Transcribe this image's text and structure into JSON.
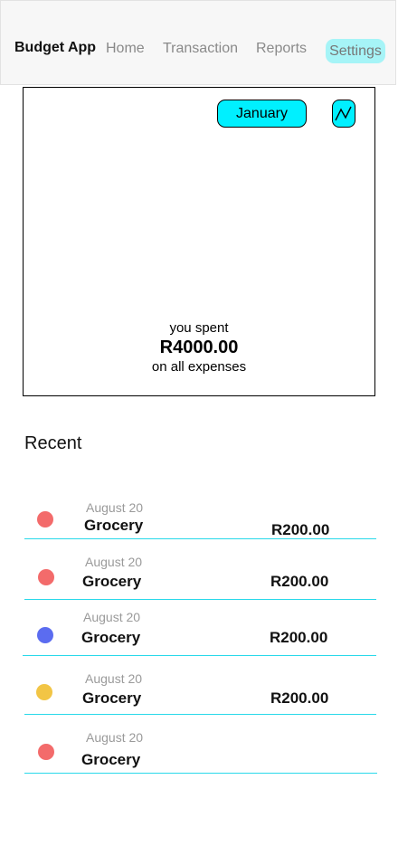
{
  "header": {
    "brand": "Budget App",
    "nav": [
      "Home",
      "Transaction",
      "Reports",
      "Settings"
    ]
  },
  "summary": {
    "month": "January",
    "chart_icon": "line-chart-icon",
    "spent_label": "you spent",
    "total": "R4000.00",
    "note": "on all expenses"
  },
  "recent": {
    "title": "Recent",
    "items": [
      {
        "date": "August 20",
        "name": "Grocery",
        "amount": "R200.00",
        "color": "#f36b6b"
      },
      {
        "date": "August 20",
        "name": "Grocery",
        "amount": "R200.00",
        "color": "#f36b6b"
      },
      {
        "date": "August 20",
        "name": "Grocery",
        "amount": "R200.00",
        "color": "#5b6cf0"
      },
      {
        "date": "August 20",
        "name": "Grocery",
        "amount": "R200.00",
        "color": "#f2c545"
      },
      {
        "date": "August 20",
        "name": "Grocery",
        "amount": "",
        "color": "#f36b6b"
      }
    ]
  },
  "colors": {
    "accent": "#00f0ff",
    "divider": "#29d9ea",
    "settings_bg": "#a6f4f7"
  }
}
